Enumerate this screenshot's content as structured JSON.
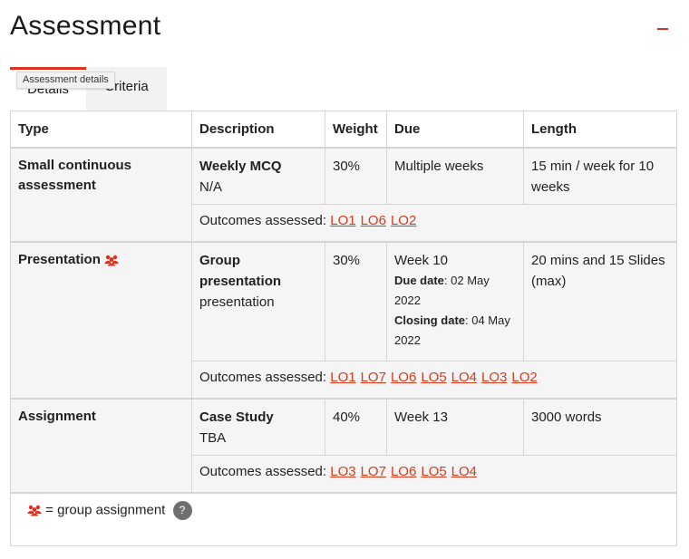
{
  "page": {
    "title": "Assessment"
  },
  "tabs": [
    {
      "label": "Details"
    },
    {
      "label": "Criteria"
    }
  ],
  "tooltip": {
    "text": "Assessment details"
  },
  "table": {
    "headers": [
      "Type",
      "Description",
      "Weight",
      "Due",
      "Length"
    ],
    "outcomes_label": "Outcomes assessed:",
    "rows": [
      {
        "type": "Small continuous assessment",
        "desc_title": "Weekly MCQ",
        "desc_sub": "N/A",
        "weight": "30%",
        "due": "Multiple weeks",
        "length": "15 min / week for 10 weeks",
        "outcomes": [
          "LO1",
          "LO6",
          "LO2"
        ]
      },
      {
        "type": "Presentation",
        "group_icon": "group-users-icon",
        "desc_title": "Group presentation",
        "desc_sub": "presentation",
        "weight": "30%",
        "due": "Week 10",
        "due_date_label": "Due date",
        "due_date": ": 02 May 2022",
        "closing_date_label": "Closing date",
        "closing_date": ": 04 May 2022",
        "length": "20 mins and 15 Slides (max)",
        "outcomes": [
          "LO1",
          "LO7",
          "LO6",
          "LO5",
          "LO4",
          "LO3",
          "LO2"
        ]
      },
      {
        "type": "Assignment",
        "desc_title": "Case Study",
        "desc_sub": "TBA",
        "weight": "40%",
        "due": "Week 13",
        "length": "3000 words",
        "outcomes": [
          "LO3",
          "LO7",
          "LO6",
          "LO5",
          "LO4"
        ]
      }
    ]
  },
  "legend": {
    "text": "= group assignment",
    "help": "?"
  },
  "colors": {
    "accent": "#e0301e",
    "link": "#d93a1a",
    "cell_bg": "#f5f5f5"
  }
}
